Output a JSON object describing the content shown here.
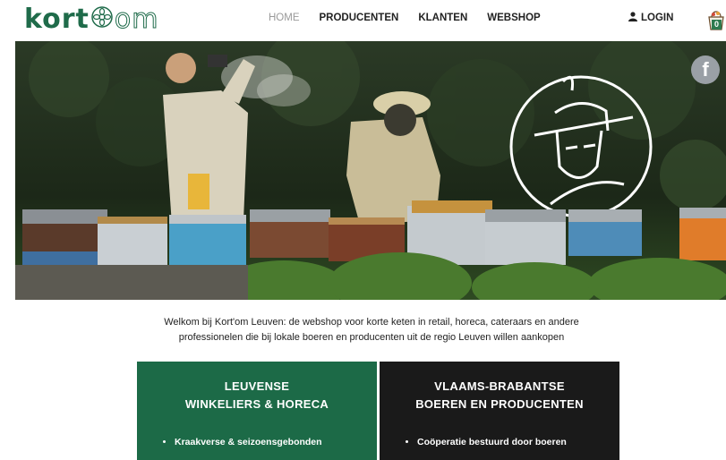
{
  "header": {
    "logo_text": "kort",
    "logo_suffix": "om",
    "nav": [
      {
        "label": "HOME",
        "active": true
      },
      {
        "label": "PRODUCENTEN",
        "active": false
      },
      {
        "label": "KLANTEN",
        "active": false
      },
      {
        "label": "WEBSHOP",
        "active": false
      }
    ],
    "login_label": "LOGIN",
    "cart_count": "0"
  },
  "social": {
    "facebook_glyph": "f"
  },
  "intro": {
    "line1": "Welkom bij Kort'om Leuven: de webshop voor korte keten in retail, horeca, cateraars en andere",
    "line2": "professionelen die bij lokale boeren en producenten uit de regio Leuven willen aankopen"
  },
  "cards": [
    {
      "title1": "LEUVENSE",
      "title2": "WINKELIERS & HORECA",
      "bullets": [
        "Kraakverse & seizoensgebonden"
      ]
    },
    {
      "title1": "VLAAMS-BRABANTSE",
      "title2": "BOEREN EN PRODUCENTEN",
      "bullets": [
        "Coöperatie bestuurd door boeren"
      ]
    }
  ],
  "colors": {
    "brand_green": "#1c6a47",
    "dark_card": "#1a1a1a"
  }
}
